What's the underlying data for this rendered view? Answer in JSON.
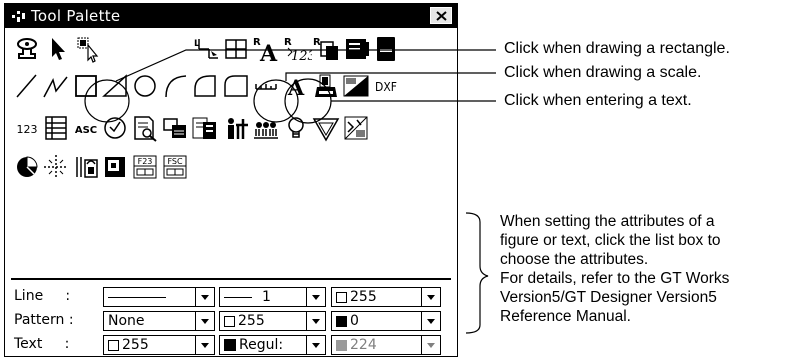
{
  "window": {
    "title": "Tool Palette",
    "close_glyph": "×"
  },
  "tools": {
    "row1": [
      "stamp-icon",
      "arrow-pointer-icon",
      "region-select-icon",
      "axis-origin-icon",
      "grid-icon",
      "text-edit-icon",
      "scale-text-icon",
      "copy-text-icon",
      "panel-icon",
      "folder-icon"
    ],
    "row2": [
      "line-icon",
      "polyline-icon",
      "rectangle-icon",
      "triangle-icon",
      "circle-icon",
      "arc-icon",
      "sector-icon",
      "scale-icon",
      "text-icon",
      "paint-icon",
      "bitmap-icon",
      "dxf-icon"
    ],
    "row3": [
      "numeric-display-icon",
      "data-list-icon",
      "ascii-icon",
      "clock-icon",
      "comment-icon",
      "alarm-icon",
      "part-icon",
      "recipe-icon",
      "history-icon",
      "lamp-icon",
      "panelkit-icon",
      "chart-icon"
    ],
    "row4": [
      "pie-icon",
      "crosshair-icon",
      "touch-switch-icon",
      "level-icon",
      "numeric-input-icon",
      "ascii-input-icon"
    ],
    "labels": {
      "text_tool": "A",
      "dxf": "DXF",
      "num": "123",
      "asc": "ASC",
      "f23": "F23",
      "fsc": "FSC"
    }
  },
  "attributes": {
    "line": {
      "label": "Line     :",
      "style_value": "",
      "width_value": "1",
      "color_value": "255"
    },
    "pattern": {
      "label": "Pattern :",
      "pattern_value": "None",
      "fg_color_value": "255",
      "bg_color_value": "0"
    },
    "text": {
      "label": "Text     :",
      "color_value": "255",
      "style_value": "Regul:",
      "shadow_value": "224"
    }
  },
  "annotations": {
    "rectangle": "Click when drawing a rectangle.",
    "scale": "Click when drawing a scale.",
    "text": "Click when entering a text.",
    "attributes_note": [
      "When setting the attributes of a",
      "figure or text, click the list box to",
      "choose the attributes.",
      "For details, refer to the GT Works",
      "Version5/GT Designer Version5",
      "Reference Manual."
    ]
  },
  "colors": {
    "titlebar": "#000000",
    "background": "#ffffff",
    "disabled_text": "#808080"
  }
}
